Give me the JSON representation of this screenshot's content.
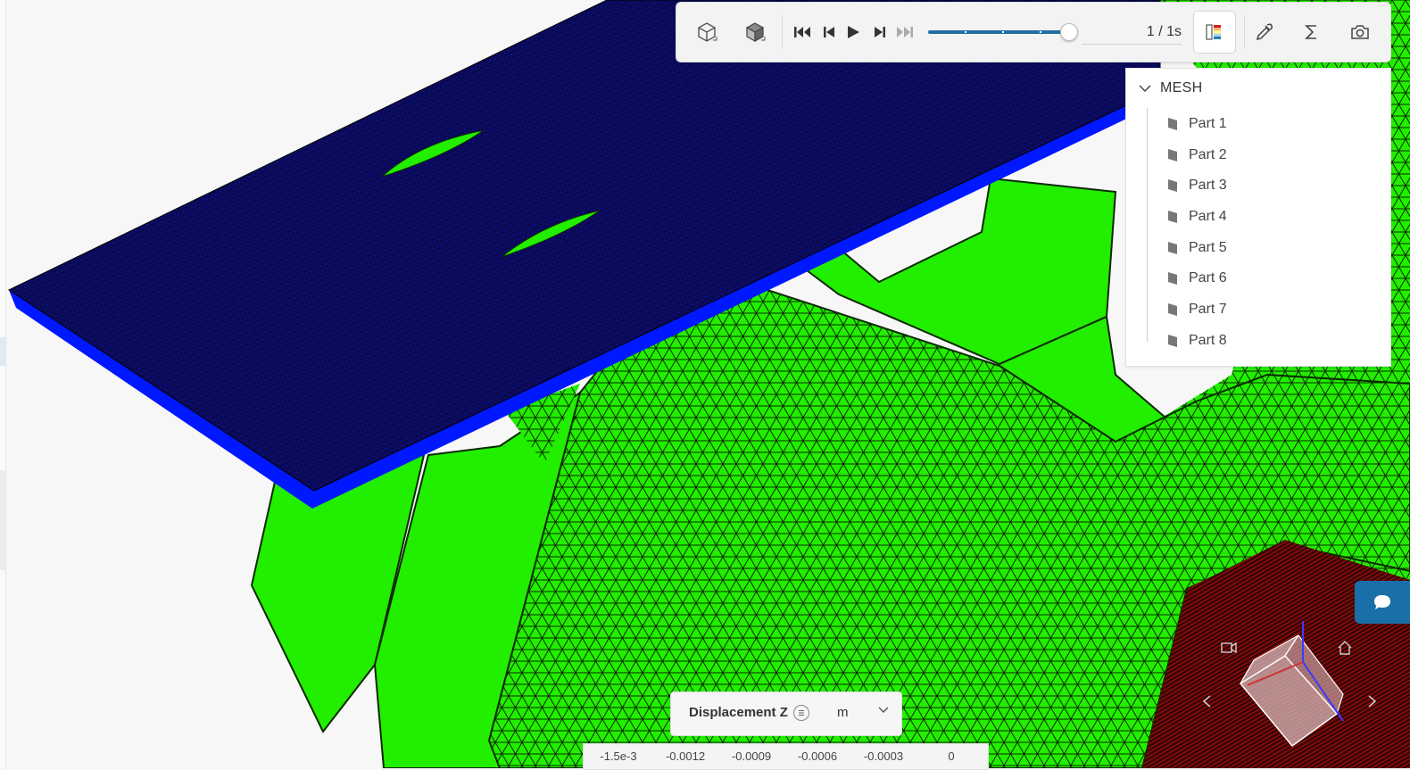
{
  "toolbar": {
    "frame_counter": "1 / 1s",
    "colormap_colors": [
      "#d7191c",
      "#fdae61",
      "#ffff8c",
      "#abd9e9",
      "#2c7bb6"
    ]
  },
  "tree": {
    "root_label": "MESH",
    "items": [
      {
        "label": "Part 1"
      },
      {
        "label": "Part 2"
      },
      {
        "label": "Part 3"
      },
      {
        "label": "Part 4"
      },
      {
        "label": "Part 5"
      },
      {
        "label": "Part 6"
      },
      {
        "label": "Part 7"
      },
      {
        "label": "Part 8"
      }
    ]
  },
  "legend": {
    "title": "Displacement Z",
    "unit": "m",
    "ticks": [
      "-1.5e-3",
      "-0.0012",
      "-0.0009",
      "-0.0006",
      "-0.0003",
      "0"
    ]
  },
  "colors": {
    "plate_top": "#0a0a6e",
    "plate_side": "#0018ff",
    "part_green": "#22ee00",
    "fixed_region": "#5a0808",
    "accent": "#1b6fa8"
  }
}
